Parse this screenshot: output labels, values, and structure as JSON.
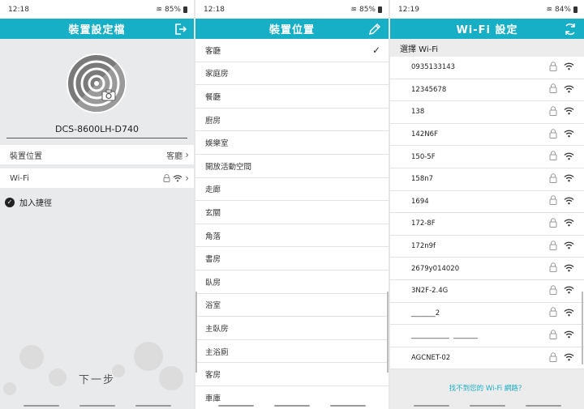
{
  "panel1": {
    "status": {
      "time": "12:18",
      "battery": "85%"
    },
    "title": "裝置設定檔",
    "device_name": "DCS-8600LH-D740",
    "rows": [
      {
        "label": "裝置位置",
        "value": "客廳"
      },
      {
        "label": "Wi-Fi",
        "value": ""
      }
    ],
    "shortcut_label": "加入捷徑",
    "next_label": "下一步"
  },
  "panel2": {
    "status": {
      "time": "12:18",
      "battery": "85%"
    },
    "title": "裝置位置",
    "locations": [
      "客廳",
      "家庭房",
      "餐廳",
      "廚房",
      "娛樂室",
      "開放活動空間",
      "走廊",
      "玄關",
      "角落",
      "書房",
      "臥房",
      "浴室",
      "主臥房",
      "主浴廁",
      "客房",
      "車庫"
    ],
    "selected_index": 0
  },
  "panel3": {
    "status": {
      "time": "12:19",
      "battery": "84%"
    },
    "title": "Wi-Fi 設定",
    "section_title": "選擇 Wi-Fi",
    "networks": [
      "0935133143",
      "12345678",
      "138",
      "142N6F",
      "150-5F",
      "158n7",
      "1694",
      "172-8F",
      "172n9f",
      "2679y014020",
      "3N2F-2.4G",
      "_______2",
      "___________  _______",
      "AGCNET-02"
    ],
    "not_found": "找不到您的 Wi-Fi 網路？"
  },
  "colors": {
    "accent": "#17afc6",
    "background": "#e9eaeb"
  }
}
